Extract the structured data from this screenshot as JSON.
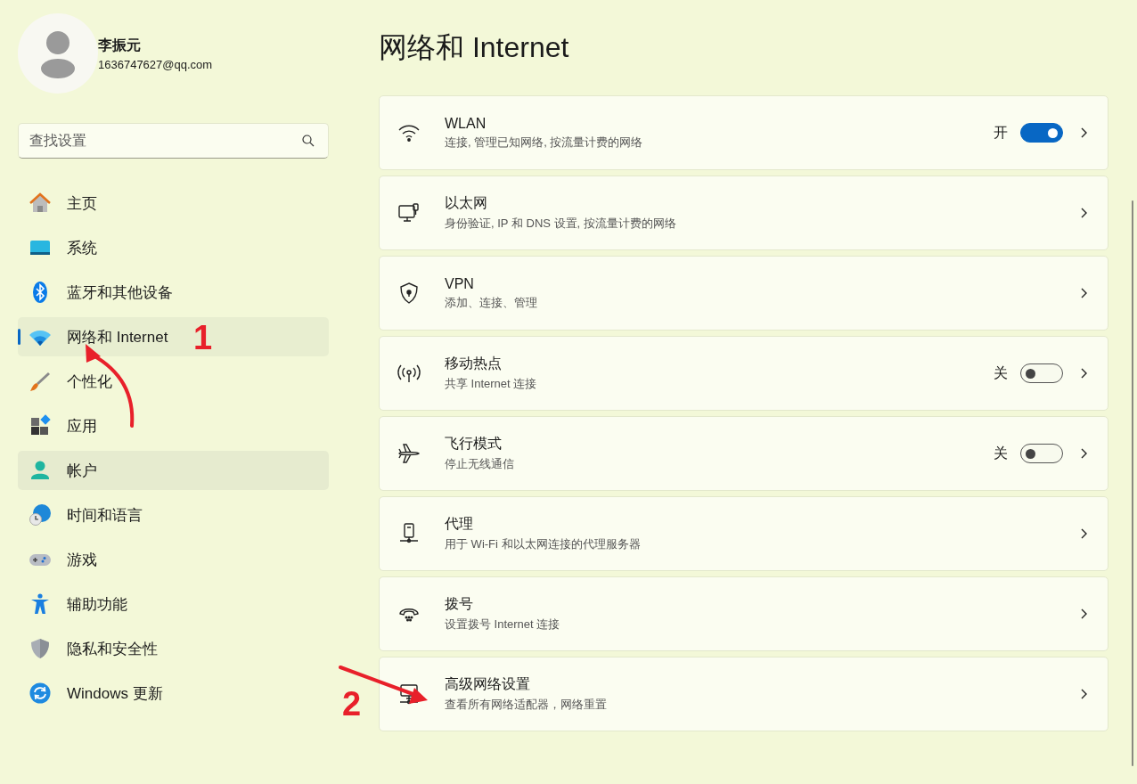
{
  "user": {
    "name": "李振元",
    "email": "1636747627@qq.com"
  },
  "search": {
    "placeholder": "查找设置"
  },
  "nav": [
    {
      "label": "主页",
      "selected": false,
      "hovered": false
    },
    {
      "label": "系统",
      "selected": false,
      "hovered": false
    },
    {
      "label": "蓝牙和其他设备",
      "selected": false,
      "hovered": false
    },
    {
      "label": "网络和 Internet",
      "selected": true,
      "hovered": false
    },
    {
      "label": "个性化",
      "selected": false,
      "hovered": false
    },
    {
      "label": "应用",
      "selected": false,
      "hovered": false
    },
    {
      "label": "帐户",
      "selected": false,
      "hovered": true
    },
    {
      "label": "时间和语言",
      "selected": false,
      "hovered": false
    },
    {
      "label": "游戏",
      "selected": false,
      "hovered": false
    },
    {
      "label": "辅助功能",
      "selected": false,
      "hovered": false
    },
    {
      "label": "隐私和安全性",
      "selected": false,
      "hovered": false
    },
    {
      "label": "Windows 更新",
      "selected": false,
      "hovered": false
    }
  ],
  "page_title": "网络和 Internet",
  "cards": [
    {
      "kind": "toggle",
      "title": "WLAN",
      "subtitle": "连接, 管理已知网络, 按流量计费的网络",
      "state_label": "开",
      "on": true
    },
    {
      "kind": "link",
      "title": "以太网",
      "subtitle": "身份验证, IP 和 DNS 设置, 按流量计费的网络"
    },
    {
      "kind": "link",
      "title": "VPN",
      "subtitle": "添加、连接、管理"
    },
    {
      "kind": "toggle",
      "title": "移动热点",
      "subtitle": "共享 Internet 连接",
      "state_label": "关",
      "on": false
    },
    {
      "kind": "toggle",
      "title": "飞行模式",
      "subtitle": "停止无线通信",
      "state_label": "关",
      "on": false
    },
    {
      "kind": "link",
      "title": "代理",
      "subtitle": "用于 Wi-Fi 和以太网连接的代理服务器"
    },
    {
      "kind": "link",
      "title": "拨号",
      "subtitle": "设置拨号 Internet 连接"
    },
    {
      "kind": "link",
      "title": "高级网络设置",
      "subtitle": "查看所有网络适配器，网络重置"
    }
  ],
  "annotations": [
    {
      "label": "1"
    },
    {
      "label": "2"
    }
  ]
}
